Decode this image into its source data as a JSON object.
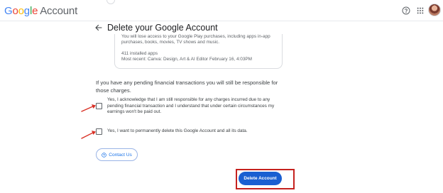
{
  "header": {
    "logo_letters": [
      "G",
      "o",
      "o",
      "g",
      "l",
      "e"
    ],
    "logo_account": "Account"
  },
  "page": {
    "title": "Delete your Google Account"
  },
  "card": {
    "clipped_line": "You will lose access to your Google Play purchases, including apps in-app",
    "text_line": "purchases, books, movies, TV shows and music.",
    "installed_apps": "411 installed apps",
    "most_recent": "Most recent: Canva: Design, Art & AI Editor February 16, 4:03PM"
  },
  "pending_note": "If you have any pending financial transactions you will still be responsible for those charges.",
  "checkboxes": {
    "acknowledge": {
      "label": "Yes, I acknowledge that I am still responsible for any charges incurred due to any pending financial transaction and I understand that under certain circumstances my earnings won't be paid out.",
      "checked": false
    },
    "permanent_delete": {
      "label": "Yes, I want to permanently delete this Google Account and all its data.",
      "checked": false
    }
  },
  "contact_button": {
    "label": "Contact Us"
  },
  "delete_button": {
    "label": "Delete Account"
  },
  "colors": {
    "primary_blue": "#1a73e8",
    "delete_button_blue": "#1a5fd1",
    "highlight_red": "#c5221f",
    "arrow_red": "#d93025"
  },
  "icons": {
    "help": "help-circle-icon",
    "apps": "apps-grid-icon",
    "back": "back-arrow-icon",
    "contact": "help-circle-icon"
  }
}
